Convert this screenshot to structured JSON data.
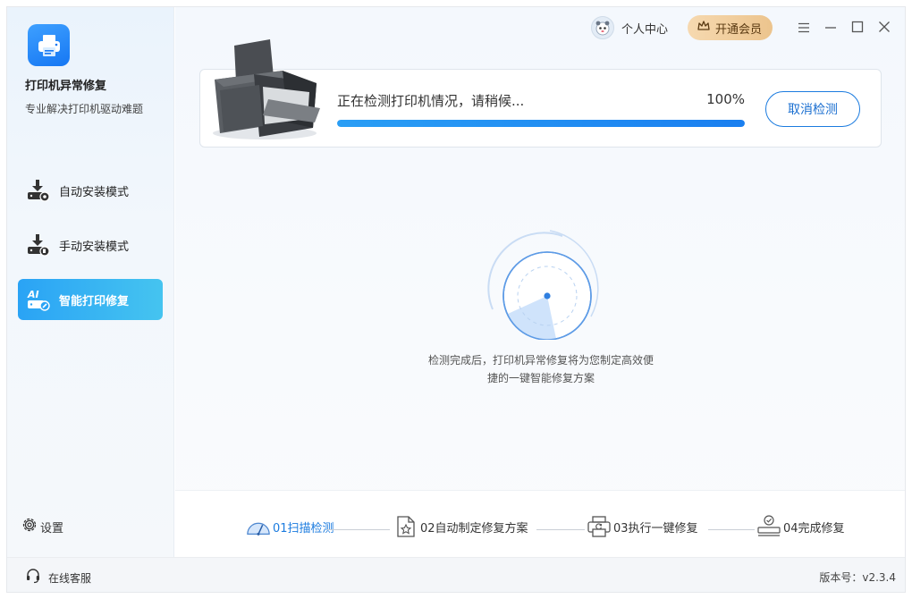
{
  "app": {
    "title": "打印机异常修复",
    "subtitle": "专业解决打印机驱动难题"
  },
  "sidebar": {
    "items": [
      {
        "label": "自动安装模式",
        "icon": "auto-install-icon",
        "active": false
      },
      {
        "label": "手动安装模式",
        "icon": "manual-install-icon",
        "active": false
      },
      {
        "label": "智能打印修复",
        "icon": "ai-repair-icon",
        "active": true
      }
    ],
    "settings_label": "设置"
  },
  "topbar": {
    "user_center_label": "个人中心",
    "vip_label": "开通会员"
  },
  "detection": {
    "status_text": "正在检测打印机情况，请稍候...",
    "percent_text": "100%",
    "progress": 1.0,
    "cancel_label": "取消检测"
  },
  "radar": {
    "hint": "检测完成后，打印机异常修复将为您制定高效便捷的一键智能修复方案"
  },
  "steps": [
    {
      "label": "01扫描检测",
      "icon": "scan-gauge-icon",
      "current": true
    },
    {
      "label": "02自动制定修复方案",
      "icon": "document-star-icon",
      "current": false
    },
    {
      "label": "03执行一键修复",
      "icon": "printer-repair-icon",
      "current": false
    },
    {
      "label": "04完成修复",
      "icon": "check-complete-icon",
      "current": false
    }
  ],
  "footer": {
    "service_label": "在线客服",
    "version_text": "版本号：v2.3.4"
  },
  "colors": {
    "accent": "#1b7bdf",
    "active_nav": "#2aa3f5",
    "vip": "#ecc48d"
  }
}
